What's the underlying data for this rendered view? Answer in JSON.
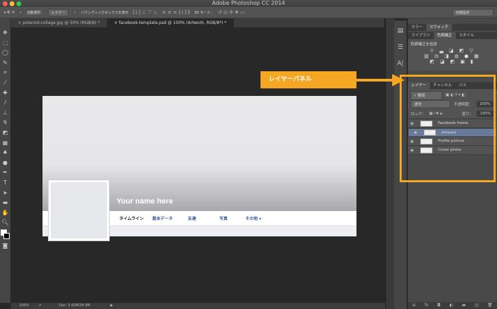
{
  "window": {
    "title": "Adobe Photoshop CC 2014"
  },
  "options_bar": {
    "auto_select_label": "自動選択：",
    "auto_select_value": "レイヤー",
    "bounding_box_label": "バウンディングボックスを表示",
    "mode_3d_label": "3D モード：",
    "workspace": "初期設定"
  },
  "doc_tabs": [
    {
      "label": "polaroid-collage.jpg @ 50% (RGB/8) *"
    },
    {
      "label": "facebook-template.psd @ 100% (Artwork, RGB/8*) *"
    }
  ],
  "document": {
    "name_text": "Your name here",
    "nav": [
      "タイムライン",
      "基本データ",
      "友達",
      "写真",
      "その他 ▾"
    ]
  },
  "status": {
    "zoom": "100%",
    "doc_size": "Doc: 3.42M/34.9M"
  },
  "panels": {
    "top_tabs": [
      "カラー",
      "スウォッチ"
    ],
    "mid_tabs": [
      "ライブラリ",
      "色調補正",
      "スタイル"
    ],
    "adjust_title": "色調補正を追加",
    "layer_tabs": [
      "レイヤー",
      "チャンネル",
      "パス"
    ],
    "filter_kind": "種類",
    "blend_mode": "通常",
    "opacity_label": "不透明度：",
    "opacity_value": "100%",
    "lock_label": "ロック：",
    "fill_label": "塗り：",
    "fill_value": "100%",
    "layers": [
      {
        "name": "Facebook frame"
      },
      {
        "name": "Artwork",
        "selected": true
      },
      {
        "name": "Profile picture"
      },
      {
        "name": "Cover photo"
      }
    ]
  },
  "callout": {
    "text": "レイヤーパネル",
    "color": "#f5a623"
  }
}
